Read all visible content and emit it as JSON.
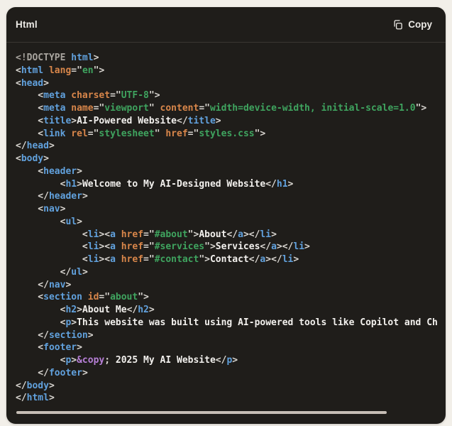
{
  "header": {
    "language_label": "Html",
    "copy_label": "Copy",
    "copy_icon": "copy-icon"
  },
  "colors": {
    "page_bg": "#f2efe9",
    "card_bg": "#1f1d1a",
    "divider": "#3a3733",
    "header_text": "#eceae6",
    "tag": "#61a1dd",
    "attr": "#d8864a",
    "str": "#3fa45f",
    "punct": "#d8d5d0",
    "text": "#f2f0ed",
    "doctype": "#a8a49e",
    "entity": "#b67fd6",
    "scrollbar": "#c6beb6"
  },
  "code": {
    "lines": [
      [
        {
          "t": "d",
          "c": "<!DOCTYPE "
        },
        {
          "t": "g",
          "c": "html"
        },
        {
          "t": "p",
          "c": ">"
        }
      ],
      [
        {
          "t": "p",
          "c": "<"
        },
        {
          "t": "g",
          "c": "html"
        },
        {
          "t": "p",
          "c": " "
        },
        {
          "t": "a",
          "c": "lang"
        },
        {
          "t": "p",
          "c": "=\""
        },
        {
          "t": "s",
          "c": "en"
        },
        {
          "t": "p",
          "c": "\">"
        }
      ],
      [
        {
          "t": "p",
          "c": "<"
        },
        {
          "t": "g",
          "c": "head"
        },
        {
          "t": "p",
          "c": ">"
        }
      ],
      [
        {
          "t": "p",
          "c": "    <"
        },
        {
          "t": "g",
          "c": "meta"
        },
        {
          "t": "p",
          "c": " "
        },
        {
          "t": "a",
          "c": "charset"
        },
        {
          "t": "p",
          "c": "=\""
        },
        {
          "t": "s",
          "c": "UTF-8"
        },
        {
          "t": "p",
          "c": "\">"
        }
      ],
      [
        {
          "t": "p",
          "c": "    <"
        },
        {
          "t": "g",
          "c": "meta"
        },
        {
          "t": "p",
          "c": " "
        },
        {
          "t": "a",
          "c": "name"
        },
        {
          "t": "p",
          "c": "=\""
        },
        {
          "t": "s",
          "c": "viewport"
        },
        {
          "t": "p",
          "c": "\" "
        },
        {
          "t": "a",
          "c": "content"
        },
        {
          "t": "p",
          "c": "=\""
        },
        {
          "t": "s",
          "c": "width=device-width, initial-scale=1.0"
        },
        {
          "t": "p",
          "c": "\">"
        }
      ],
      [
        {
          "t": "p",
          "c": "    <"
        },
        {
          "t": "g",
          "c": "title"
        },
        {
          "t": "p",
          "c": ">"
        },
        {
          "t": "x",
          "c": "AI-Powered Website"
        },
        {
          "t": "p",
          "c": "</"
        },
        {
          "t": "g",
          "c": "title"
        },
        {
          "t": "p",
          "c": ">"
        }
      ],
      [
        {
          "t": "p",
          "c": "    <"
        },
        {
          "t": "g",
          "c": "link"
        },
        {
          "t": "p",
          "c": " "
        },
        {
          "t": "a",
          "c": "rel"
        },
        {
          "t": "p",
          "c": "=\""
        },
        {
          "t": "s",
          "c": "stylesheet"
        },
        {
          "t": "p",
          "c": "\" "
        },
        {
          "t": "a",
          "c": "href"
        },
        {
          "t": "p",
          "c": "=\""
        },
        {
          "t": "s",
          "c": "styles.css"
        },
        {
          "t": "p",
          "c": "\">"
        }
      ],
      [
        {
          "t": "p",
          "c": "</"
        },
        {
          "t": "g",
          "c": "head"
        },
        {
          "t": "p",
          "c": ">"
        }
      ],
      [
        {
          "t": "p",
          "c": "<"
        },
        {
          "t": "g",
          "c": "body"
        },
        {
          "t": "p",
          "c": ">"
        }
      ],
      [
        {
          "t": "p",
          "c": "    <"
        },
        {
          "t": "g",
          "c": "header"
        },
        {
          "t": "p",
          "c": ">"
        }
      ],
      [
        {
          "t": "p",
          "c": "        <"
        },
        {
          "t": "g",
          "c": "h1"
        },
        {
          "t": "p",
          "c": ">"
        },
        {
          "t": "x",
          "c": "Welcome to My AI-Designed Website"
        },
        {
          "t": "p",
          "c": "</"
        },
        {
          "t": "g",
          "c": "h1"
        },
        {
          "t": "p",
          "c": ">"
        }
      ],
      [
        {
          "t": "p",
          "c": "    </"
        },
        {
          "t": "g",
          "c": "header"
        },
        {
          "t": "p",
          "c": ">"
        }
      ],
      [
        {
          "t": "p",
          "c": "    <"
        },
        {
          "t": "g",
          "c": "nav"
        },
        {
          "t": "p",
          "c": ">"
        }
      ],
      [
        {
          "t": "p",
          "c": "        <"
        },
        {
          "t": "g",
          "c": "ul"
        },
        {
          "t": "p",
          "c": ">"
        }
      ],
      [
        {
          "t": "p",
          "c": "            <"
        },
        {
          "t": "g",
          "c": "li"
        },
        {
          "t": "p",
          "c": "><"
        },
        {
          "t": "g",
          "c": "a"
        },
        {
          "t": "p",
          "c": " "
        },
        {
          "t": "a",
          "c": "href"
        },
        {
          "t": "p",
          "c": "=\""
        },
        {
          "t": "s",
          "c": "#about"
        },
        {
          "t": "p",
          "c": "\">"
        },
        {
          "t": "x",
          "c": "About"
        },
        {
          "t": "p",
          "c": "</"
        },
        {
          "t": "g",
          "c": "a"
        },
        {
          "t": "p",
          "c": "></"
        },
        {
          "t": "g",
          "c": "li"
        },
        {
          "t": "p",
          "c": ">"
        }
      ],
      [
        {
          "t": "p",
          "c": "            <"
        },
        {
          "t": "g",
          "c": "li"
        },
        {
          "t": "p",
          "c": "><"
        },
        {
          "t": "g",
          "c": "a"
        },
        {
          "t": "p",
          "c": " "
        },
        {
          "t": "a",
          "c": "href"
        },
        {
          "t": "p",
          "c": "=\""
        },
        {
          "t": "s",
          "c": "#services"
        },
        {
          "t": "p",
          "c": "\">"
        },
        {
          "t": "x",
          "c": "Services"
        },
        {
          "t": "p",
          "c": "</"
        },
        {
          "t": "g",
          "c": "a"
        },
        {
          "t": "p",
          "c": "></"
        },
        {
          "t": "g",
          "c": "li"
        },
        {
          "t": "p",
          "c": ">"
        }
      ],
      [
        {
          "t": "p",
          "c": "            <"
        },
        {
          "t": "g",
          "c": "li"
        },
        {
          "t": "p",
          "c": "><"
        },
        {
          "t": "g",
          "c": "a"
        },
        {
          "t": "p",
          "c": " "
        },
        {
          "t": "a",
          "c": "href"
        },
        {
          "t": "p",
          "c": "=\""
        },
        {
          "t": "s",
          "c": "#contact"
        },
        {
          "t": "p",
          "c": "\">"
        },
        {
          "t": "x",
          "c": "Contact"
        },
        {
          "t": "p",
          "c": "</"
        },
        {
          "t": "g",
          "c": "a"
        },
        {
          "t": "p",
          "c": "></"
        },
        {
          "t": "g",
          "c": "li"
        },
        {
          "t": "p",
          "c": ">"
        }
      ],
      [
        {
          "t": "p",
          "c": "        </"
        },
        {
          "t": "g",
          "c": "ul"
        },
        {
          "t": "p",
          "c": ">"
        }
      ],
      [
        {
          "t": "p",
          "c": "    </"
        },
        {
          "t": "g",
          "c": "nav"
        },
        {
          "t": "p",
          "c": ">"
        }
      ],
      [
        {
          "t": "p",
          "c": "    <"
        },
        {
          "t": "g",
          "c": "section"
        },
        {
          "t": "p",
          "c": " "
        },
        {
          "t": "a",
          "c": "id"
        },
        {
          "t": "p",
          "c": "=\""
        },
        {
          "t": "s",
          "c": "about"
        },
        {
          "t": "p",
          "c": "\">"
        }
      ],
      [
        {
          "t": "p",
          "c": "        <"
        },
        {
          "t": "g",
          "c": "h2"
        },
        {
          "t": "p",
          "c": ">"
        },
        {
          "t": "x",
          "c": "About Me"
        },
        {
          "t": "p",
          "c": "</"
        },
        {
          "t": "g",
          "c": "h2"
        },
        {
          "t": "p",
          "c": ">"
        }
      ],
      [
        {
          "t": "p",
          "c": "        <"
        },
        {
          "t": "g",
          "c": "p"
        },
        {
          "t": "p",
          "c": ">"
        },
        {
          "t": "x",
          "c": "This website was built using AI-powered tools like Copilot and Ch"
        }
      ],
      [
        {
          "t": "p",
          "c": "    </"
        },
        {
          "t": "g",
          "c": "section"
        },
        {
          "t": "p",
          "c": ">"
        }
      ],
      [
        {
          "t": "p",
          "c": "    <"
        },
        {
          "t": "g",
          "c": "footer"
        },
        {
          "t": "p",
          "c": ">"
        }
      ],
      [
        {
          "t": "p",
          "c": "        <"
        },
        {
          "t": "g",
          "c": "p"
        },
        {
          "t": "p",
          "c": ">"
        },
        {
          "t": "e",
          "c": "&copy"
        },
        {
          "t": "p",
          "c": ";"
        },
        {
          "t": "x",
          "c": " 2025 My AI Website"
        },
        {
          "t": "p",
          "c": "</"
        },
        {
          "t": "g",
          "c": "p"
        },
        {
          "t": "p",
          "c": ">"
        }
      ],
      [
        {
          "t": "p",
          "c": "    </"
        },
        {
          "t": "g",
          "c": "footer"
        },
        {
          "t": "p",
          "c": ">"
        }
      ],
      [
        {
          "t": "p",
          "c": "</"
        },
        {
          "t": "g",
          "c": "body"
        },
        {
          "t": "p",
          "c": ">"
        }
      ],
      [
        {
          "t": "p",
          "c": "</"
        },
        {
          "t": "g",
          "c": "html"
        },
        {
          "t": "p",
          "c": ">"
        }
      ]
    ]
  }
}
